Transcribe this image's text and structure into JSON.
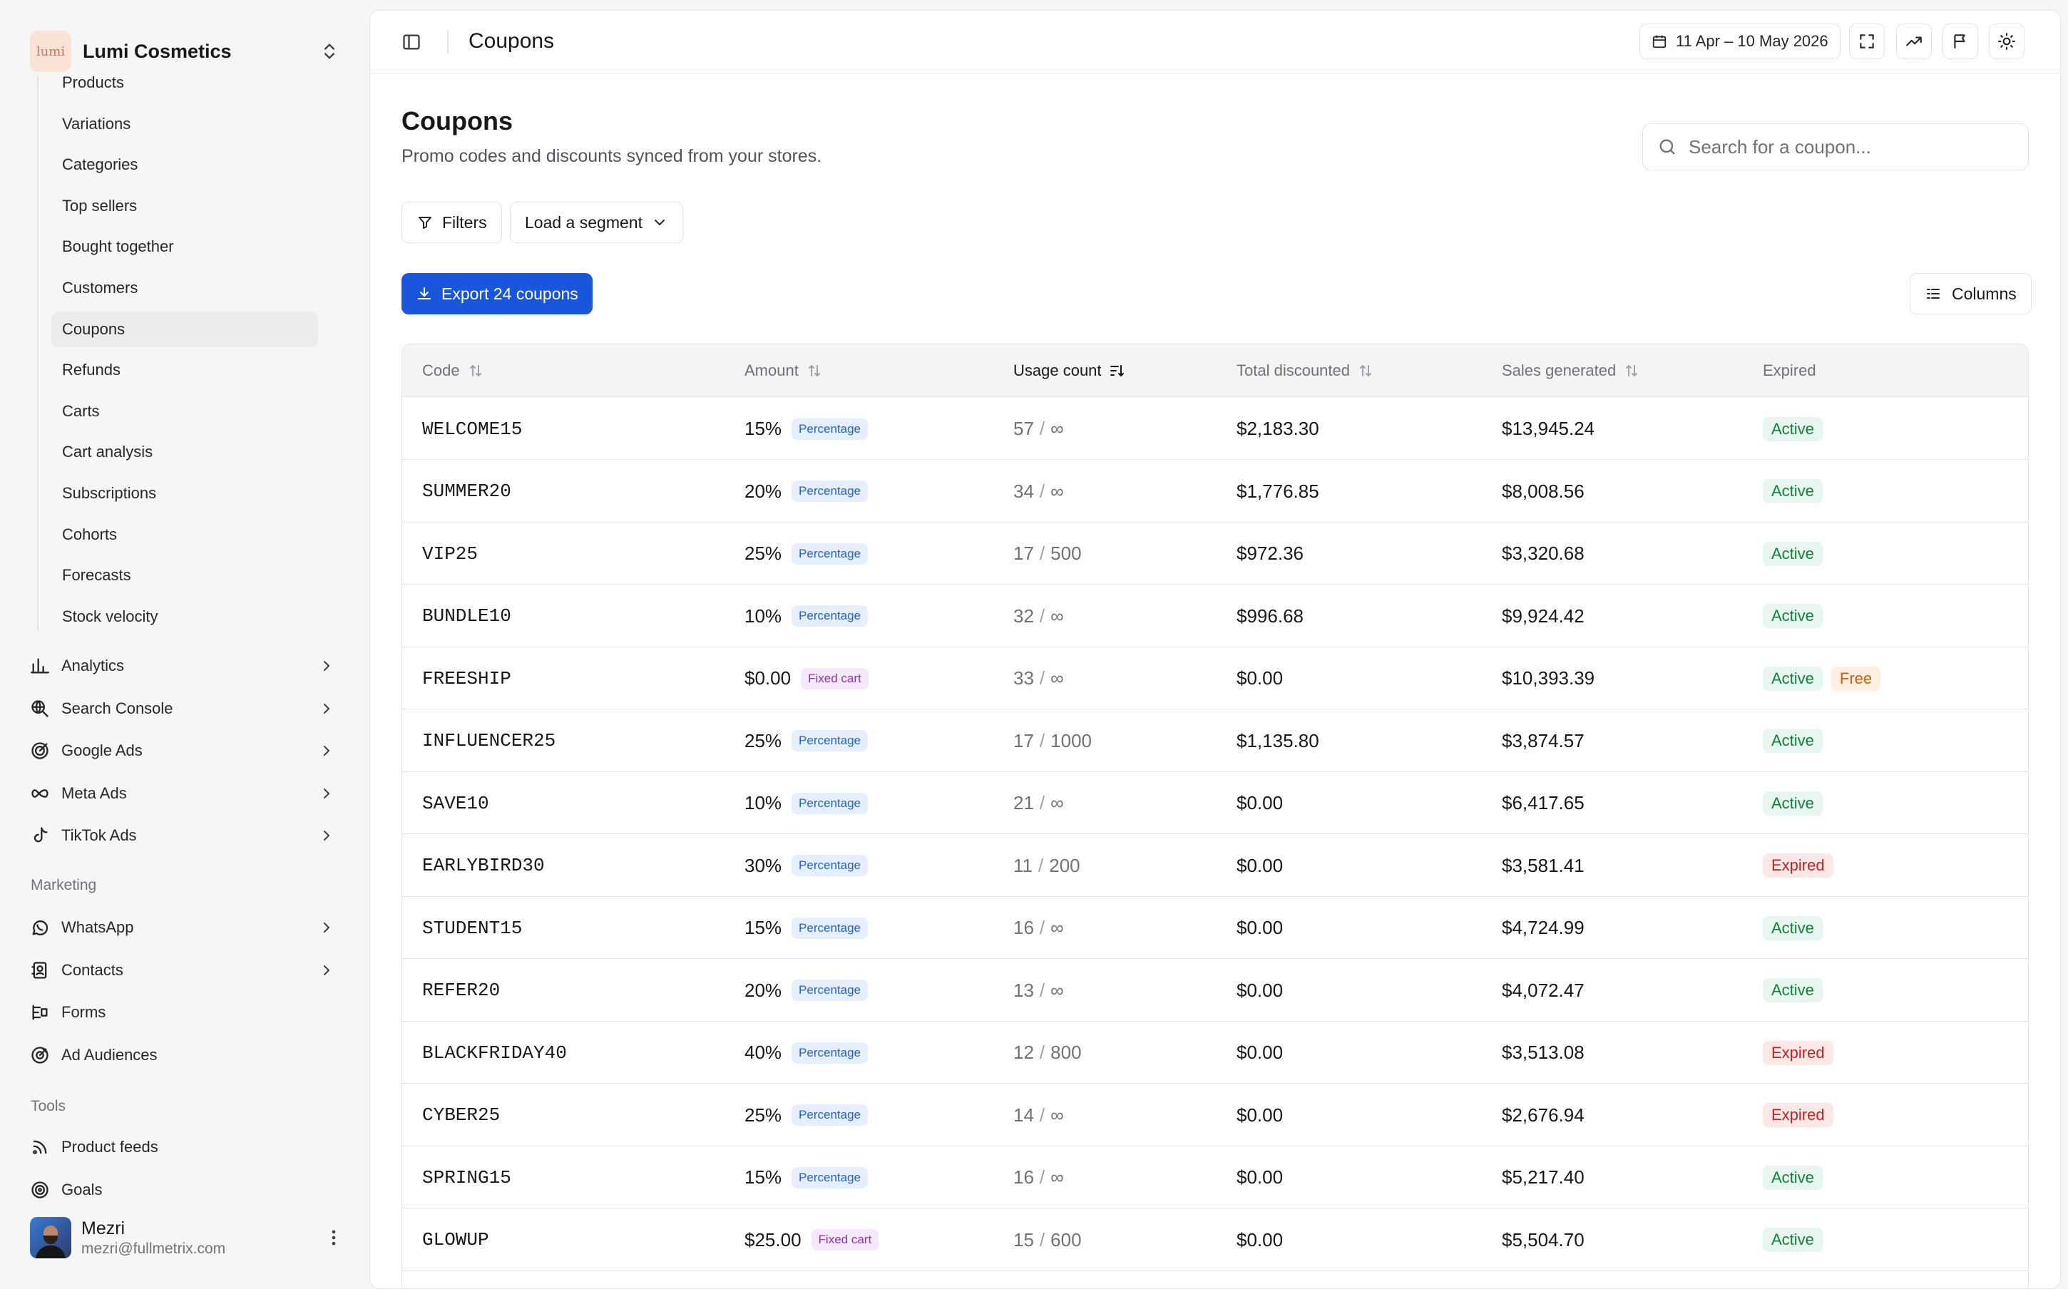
{
  "brand": {
    "logo_text": "lumi",
    "name": "Lumi Cosmetics"
  },
  "sidebar": {
    "sub_items": [
      "Products",
      "Variations",
      "Categories",
      "Top sellers",
      "Bought together",
      "Customers",
      "Coupons",
      "Refunds",
      "Carts",
      "Cart analysis",
      "Subscriptions",
      "Cohorts",
      "Forecasts",
      "Stock velocity"
    ],
    "active_sub_item": "Coupons",
    "groups": [
      {
        "label": "Analytics",
        "icon": "bar-chart-icon"
      },
      {
        "label": "Search Console",
        "icon": "search-globe-icon"
      },
      {
        "label": "Google Ads",
        "icon": "target-icon"
      },
      {
        "label": "Meta Ads",
        "icon": "infinity-icon"
      },
      {
        "label": "TikTok Ads",
        "icon": "tiktok-icon"
      }
    ],
    "marketing_label": "Marketing",
    "marketing": [
      {
        "label": "WhatsApp",
        "icon": "whatsapp-icon"
      },
      {
        "label": "Contacts",
        "icon": "contacts-icon"
      },
      {
        "label": "Forms",
        "icon": "form-icon"
      },
      {
        "label": "Ad Audiences",
        "icon": "audience-icon"
      }
    ],
    "tools_label": "Tools",
    "tools": [
      {
        "label": "Product feeds",
        "icon": "rss-icon"
      },
      {
        "label": "Goals",
        "icon": "goal-icon"
      }
    ]
  },
  "user": {
    "name": "Mezri",
    "email": "mezri@fullmetrix.com"
  },
  "topbar": {
    "title": "Coupons",
    "date_range": "11 Apr – 10 May 2026"
  },
  "page": {
    "title": "Coupons",
    "subtitle": "Promo codes and discounts synced from your stores.",
    "search_placeholder": "Search for a coupon...",
    "filters_label": "Filters",
    "segment_label": "Load a segment",
    "export_label": "Export 24 coupons",
    "columns_label": "Columns"
  },
  "table": {
    "headers": {
      "code": "Code",
      "amount": "Amount",
      "usage": "Usage count",
      "total": "Total discounted",
      "sales": "Sales generated",
      "expired": "Expired"
    },
    "rows": [
      {
        "code": "WELCOME15",
        "amount": "15%",
        "type": "Percentage",
        "used": "57",
        "limit": "∞",
        "total": "$2,183.30",
        "sales": "$13,945.24",
        "status": "Active"
      },
      {
        "code": "SUMMER20",
        "amount": "20%",
        "type": "Percentage",
        "used": "34",
        "limit": "∞",
        "total": "$1,776.85",
        "sales": "$8,008.56",
        "status": "Active"
      },
      {
        "code": "VIP25",
        "amount": "25%",
        "type": "Percentage",
        "used": "17",
        "limit": "500",
        "total": "$972.36",
        "sales": "$3,320.68",
        "status": "Active"
      },
      {
        "code": "BUNDLE10",
        "amount": "10%",
        "type": "Percentage",
        "used": "32",
        "limit": "∞",
        "total": "$996.68",
        "sales": "$9,924.42",
        "status": "Active"
      },
      {
        "code": "FREESHIP",
        "amount": "$0.00",
        "type": "Fixed cart",
        "used": "33",
        "limit": "∞",
        "total": "$0.00",
        "sales": "$10,393.39",
        "status": "Active",
        "extra": "Free"
      },
      {
        "code": "INFLUENCER25",
        "amount": "25%",
        "type": "Percentage",
        "used": "17",
        "limit": "1000",
        "total": "$1,135.80",
        "sales": "$3,874.57",
        "status": "Active"
      },
      {
        "code": "SAVE10",
        "amount": "10%",
        "type": "Percentage",
        "used": "21",
        "limit": "∞",
        "total": "$0.00",
        "sales": "$6,417.65",
        "status": "Active"
      },
      {
        "code": "EARLYBIRD30",
        "amount": "30%",
        "type": "Percentage",
        "used": "11",
        "limit": "200",
        "total": "$0.00",
        "sales": "$3,581.41",
        "status": "Expired"
      },
      {
        "code": "STUDENT15",
        "amount": "15%",
        "type": "Percentage",
        "used": "16",
        "limit": "∞",
        "total": "$0.00",
        "sales": "$4,724.99",
        "status": "Active"
      },
      {
        "code": "REFER20",
        "amount": "20%",
        "type": "Percentage",
        "used": "13",
        "limit": "∞",
        "total": "$0.00",
        "sales": "$4,072.47",
        "status": "Active"
      },
      {
        "code": "BLACKFRIDAY40",
        "amount": "40%",
        "type": "Percentage",
        "used": "12",
        "limit": "800",
        "total": "$0.00",
        "sales": "$3,513.08",
        "status": "Expired"
      },
      {
        "code": "CYBER25",
        "amount": "25%",
        "type": "Percentage",
        "used": "14",
        "limit": "∞",
        "total": "$0.00",
        "sales": "$2,676.94",
        "status": "Expired"
      },
      {
        "code": "SPRING15",
        "amount": "15%",
        "type": "Percentage",
        "used": "16",
        "limit": "∞",
        "total": "$0.00",
        "sales": "$5,217.40",
        "status": "Active"
      },
      {
        "code": "GLOWUP",
        "amount": "$25.00",
        "type": "Fixed cart",
        "used": "15",
        "limit": "600",
        "total": "$0.00",
        "sales": "$5,504.70",
        "status": "Active"
      }
    ]
  },
  "colors": {
    "primary": "#1a56db",
    "active_bg": "#e7f6ee",
    "active_text": "#15803d",
    "expired_bg": "#fde8e8",
    "expired_text": "#c42121",
    "free_text": "#c2620f"
  }
}
